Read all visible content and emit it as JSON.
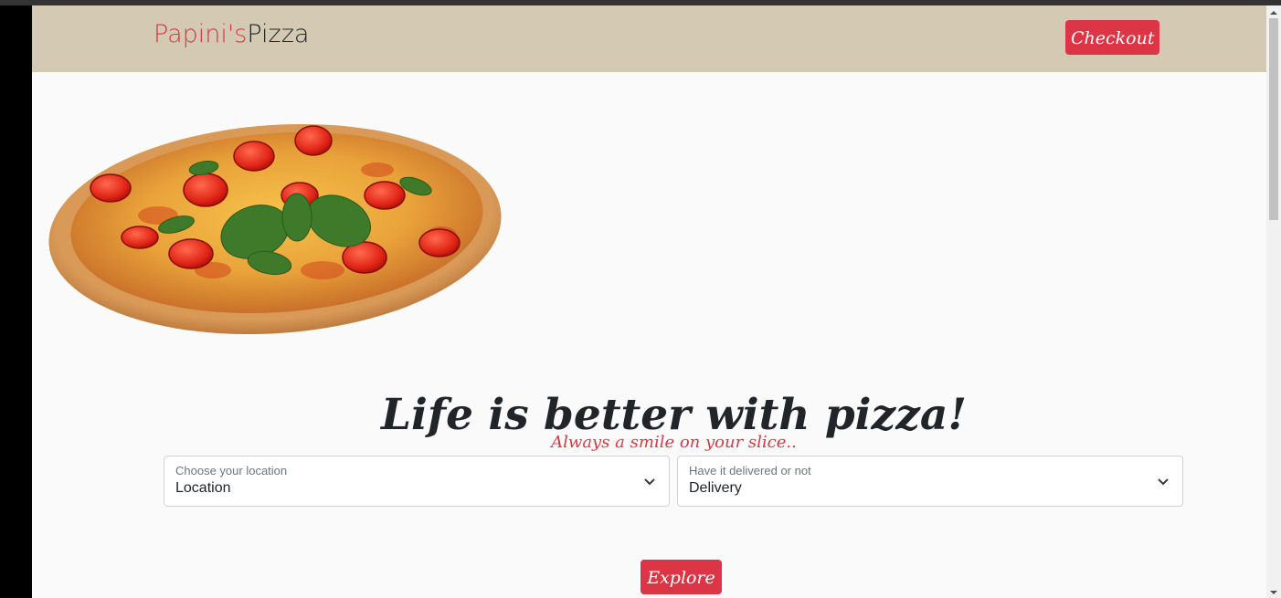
{
  "navbar": {
    "brand_part1": "Papini's",
    "brand_part2": "Pizza",
    "checkout_label": "Checkout"
  },
  "hero": {
    "headline": "Life is better with pizza!",
    "tagline": "Always a smile on your slice.."
  },
  "filters": {
    "location": {
      "label": "Choose your location",
      "value": "Location",
      "icon": "chevron-down-icon"
    },
    "delivery": {
      "label": "Have it delivered or not",
      "value": "Delivery",
      "icon": "chevron-down-icon"
    }
  },
  "actions": {
    "explore_label": "Explore"
  },
  "colors": {
    "accent": "#dc3545",
    "navbar_bg": "#d4cab3",
    "page_bg": "#fafafa",
    "text": "#212529"
  }
}
